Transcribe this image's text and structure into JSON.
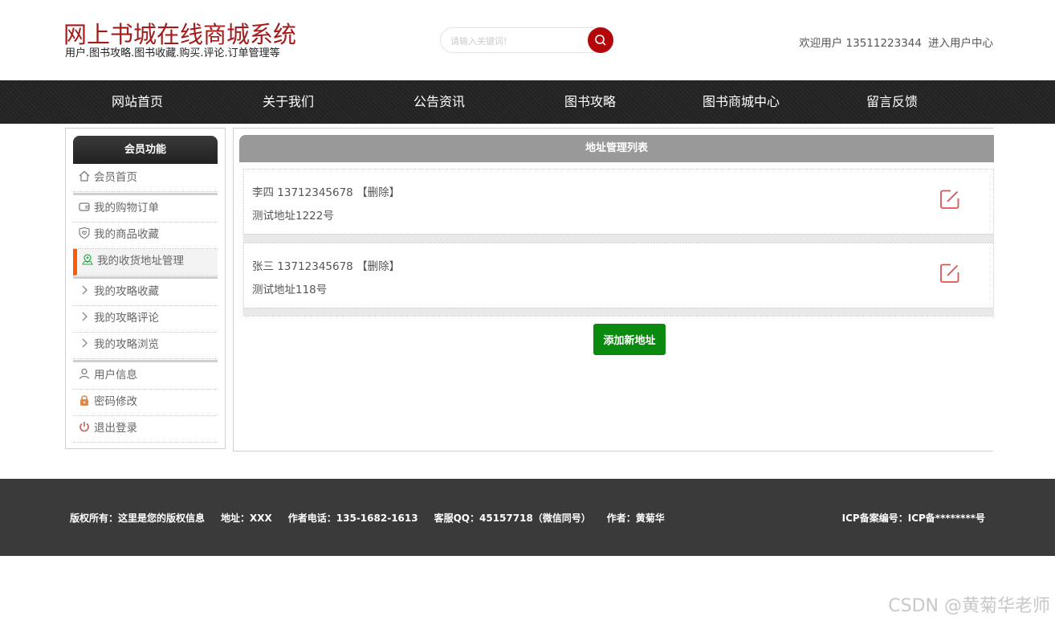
{
  "header": {
    "title": "网上书城在线商城系统",
    "subtitle": "用户.图书攻略.图书收藏.购买.评论.订单管理等",
    "search_placeholder": "请输入关键词!",
    "welcome_prefix": "欢迎用户 13511223344",
    "user_center": "进入用户中心"
  },
  "nav": [
    "网站首页",
    "关于我们",
    "公告资讯",
    "图书攻略",
    "图书商城中心",
    "留言反馈"
  ],
  "sidebar": {
    "title": "会员功能",
    "items": [
      {
        "label": "会员首页",
        "icon": "home-icon"
      },
      {
        "label": "我的购物订单",
        "icon": "wallet-icon"
      },
      {
        "label": "我的商品收藏",
        "icon": "heart-shield-icon"
      },
      {
        "label": "我的收货地址管理",
        "icon": "map-pin-icon"
      },
      {
        "label": "我的攻略收藏",
        "icon": "chevron-right-icon"
      },
      {
        "label": "我的攻略评论",
        "icon": "chevron-right-icon"
      },
      {
        "label": "我的攻略浏览",
        "icon": "chevron-right-icon"
      },
      {
        "label": "用户信息",
        "icon": "user-icon"
      },
      {
        "label": "密码修改",
        "icon": "lock-icon"
      },
      {
        "label": "退出登录",
        "icon": "power-icon"
      }
    ],
    "active_index": 3
  },
  "main": {
    "title": "地址管理列表",
    "addresses": [
      {
        "name_phone": "李四 13712345678",
        "delete_label": "【删除】",
        "address": "测试地址1222号"
      },
      {
        "name_phone": "张三 13712345678",
        "delete_label": "【删除】",
        "address": "测试地址118号"
      }
    ],
    "add_button": "添加新地址"
  },
  "footer": {
    "copyright": "版权所有：这里是您的版权信息",
    "address": "地址：XXX",
    "phone": "作者电话：135-1682-1613",
    "qq": "客服QQ：45157718（微信同号）",
    "author": "作者：黄菊华",
    "icp": "ICP备案编号：ICP备********号"
  },
  "watermark": "CSDN @黄菊华老师",
  "colors": {
    "brand_red": "#a31b1b",
    "search_button": "#b3070b",
    "nav_bg": "#222222",
    "active_accent": "#ff5a00",
    "add_button": "#0c8a10",
    "edit_icon": "#e05050",
    "footer_bg": "#3a3a3a"
  }
}
